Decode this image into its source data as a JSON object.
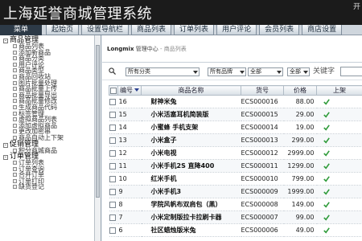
{
  "header": {
    "title": "上海延誉商城管理系统",
    "corner": "开"
  },
  "nav": {
    "menu_label": "菜单",
    "tabs": [
      "起始页",
      "设置导航栏",
      "商品列表",
      "订单列表",
      "用户评论",
      "会员列表",
      "商店设置"
    ]
  },
  "sidebar": {
    "groups": [
      {
        "label": "商品管理",
        "items": [
          "商品列表",
          "添加新商品",
          "商品分类",
          "用户评论",
          "商品类型",
          "商品回收站",
          "图片批量处理",
          "商品批量上传",
          "商品批量导出",
          "商品批量修改",
          "生成商品代码",
          "标签管理",
          "虚拟商品列表",
          "添加虚拟商品",
          "更改加密串",
          "商品自动上下架"
        ]
      },
      {
        "label": "促销管理",
        "items": [
          "积分商城商品"
        ]
      },
      {
        "label": "订单管理",
        "items": [
          "订单列表",
          "订单查询",
          "合并订单",
          "订单打印",
          "缺货登记"
        ]
      }
    ]
  },
  "breadcrumb": {
    "root": "Longmix",
    "section": "管理中心",
    "separator": " - ",
    "current": "商品列表"
  },
  "filters": {
    "category": "所有分类",
    "brand": "所有品牌",
    "all1": "全部",
    "all2": "全部",
    "all3": "全部",
    "keyword_label": "关键字"
  },
  "table": {
    "headers": {
      "id": "编号",
      "name": "商品名称",
      "sn": "货号",
      "price": "价格",
      "flag": "上架"
    },
    "rows": [
      {
        "id": "16",
        "name": "财神米兔",
        "sn": "ECS000016",
        "price": "88.00"
      },
      {
        "id": "15",
        "name": "小米活塞耳机简装版",
        "sn": "ECS000015",
        "price": "29.00"
      },
      {
        "id": "14",
        "name": "小蜜蜂 手机支架",
        "sn": "ECS000014",
        "price": "19.00"
      },
      {
        "id": "13",
        "name": "小米盒子",
        "sn": "ECS000013",
        "price": "299.00"
      },
      {
        "id": "12",
        "name": "小米电视",
        "sn": "ECS000012",
        "price": "2999.00"
      },
      {
        "id": "11",
        "name": "小米手机2S 直降400",
        "sn": "ECS000011",
        "price": "1299.00"
      },
      {
        "id": "10",
        "name": "红米手机",
        "sn": "ECS000010",
        "price": "799.00"
      },
      {
        "id": "9",
        "name": "小米手机3",
        "sn": "ECS000009",
        "price": "1999.00"
      },
      {
        "id": "8",
        "name": "学院风帆布双肩包（黑）",
        "sn": "ECS000008",
        "price": "149.00"
      },
      {
        "id": "7",
        "name": "小米定制版拉卡拉刷卡器",
        "sn": "ECS000007",
        "price": "99.00"
      },
      {
        "id": "6",
        "name": "社区蜡烛版米兔",
        "sn": "ECS000006",
        "price": "49.00"
      }
    ]
  },
  "colors": {
    "header_bg": "#1b1b1b",
    "menu_bg": "#2d3a47",
    "link_blue": "#2a3f8f",
    "ok_green": "#2f9b3a"
  }
}
